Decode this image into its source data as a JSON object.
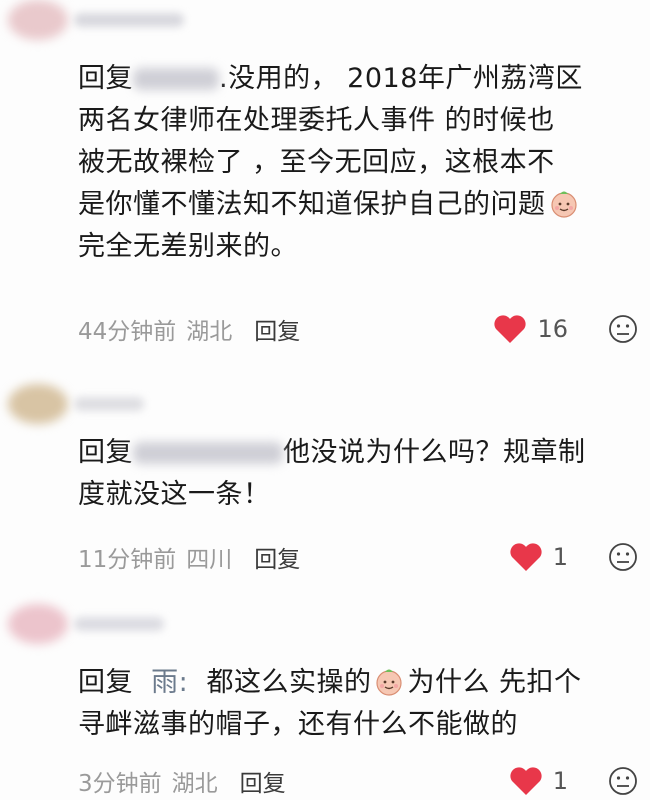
{
  "comments": [
    {
      "reply_prefix": "回复",
      "text": [
        ".没用的，  2018年广州荔湾区",
        "两名女律师在处理委托人事件  的时候也",
        "被无故裸检了     ，至今无回应，这根本不",
        "是你懂不懂法知不知道保护自己的问题",
        "完全无差别来的。"
      ],
      "time": "44分钟前",
      "location": "湖北",
      "reply_label": "回复",
      "likes": "16"
    },
    {
      "reply_prefix": "回复",
      "text": [
        "他没说为什么吗？规章制",
        "度就没这一条！"
      ],
      "time": "11分钟前",
      "location": "四川",
      "reply_label": "回复",
      "likes": "1"
    },
    {
      "reply_prefix": "回复",
      "reply_name": "雨:",
      "text": [
        "都这么实操的",
        "为什么 先扣个",
        "寻衅滋事的帽子，还有什么不能做的"
      ],
      "time": "3分钟前",
      "location": "湖北",
      "reply_label": "回复",
      "likes": "1"
    }
  ],
  "colors": {
    "heart": "#e8374a",
    "meta": "#9a9a9a",
    "reply_name": "#6b7a8c"
  },
  "icons": [
    "heart-icon",
    "dislike-face-icon",
    "smiling-emoji-icon"
  ]
}
